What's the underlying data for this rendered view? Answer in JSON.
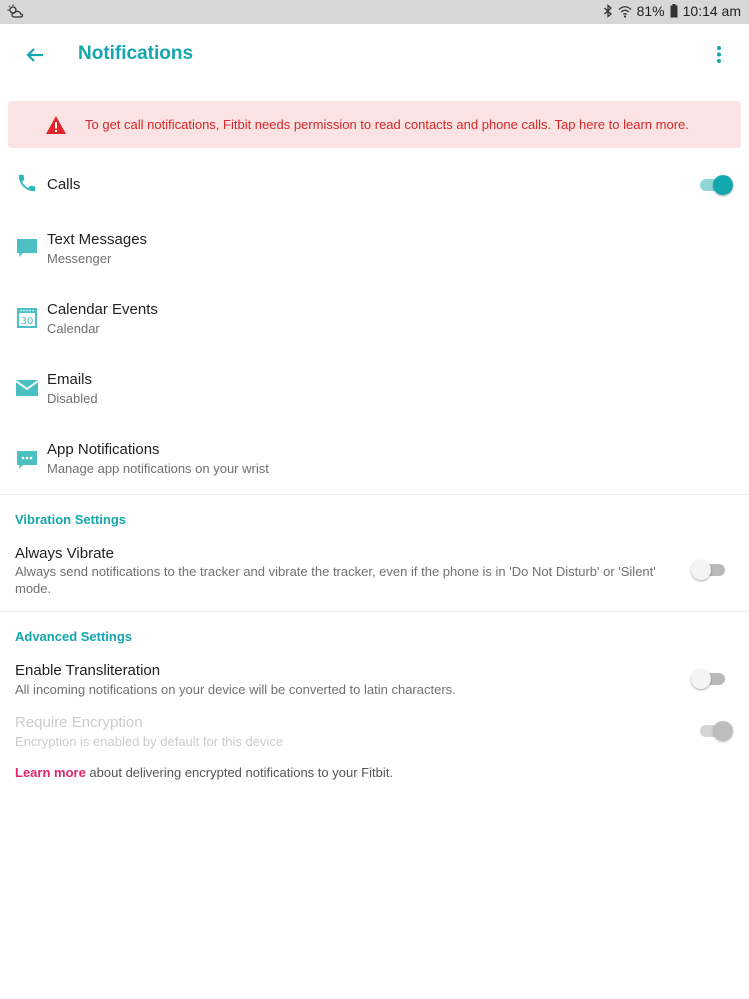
{
  "status_bar": {
    "battery": "81%",
    "time": "10:14 am",
    "icons": [
      "weather-icon",
      "bluetooth-icon",
      "wifi-icon",
      "battery-icon"
    ]
  },
  "header": {
    "title": "Notifications",
    "back_icon": "arrow-back-icon",
    "menu_icon": "more-vert-icon"
  },
  "banner": {
    "text": "To get call notifications, Fitbit needs permission to read contacts and phone calls. Tap here to learn more.",
    "icon": "warning-icon",
    "color": "#d8262a"
  },
  "notification_types": [
    {
      "title": "Calls",
      "subtitle": "",
      "icon": "phone-icon",
      "enabled": true
    },
    {
      "title": "Text Messages",
      "subtitle": "Messenger",
      "icon": "chat-bubble-icon"
    },
    {
      "title": "Calendar Events",
      "subtitle": "Calendar",
      "icon": "calendar-icon",
      "icon_text": "30"
    },
    {
      "title": "Emails",
      "subtitle": "Disabled",
      "icon": "envelope-icon"
    },
    {
      "title": "App Notifications",
      "subtitle": "Manage app notifications on your wrist",
      "icon": "app-chat-icon"
    }
  ],
  "vibration": {
    "section_title": "Vibration Settings",
    "always_vibrate": {
      "title": "Always Vibrate",
      "subtitle": "Always send notifications to the tracker and vibrate the tracker, even if the phone is in 'Do Not Disturb' or 'Silent' mode.",
      "enabled": false
    }
  },
  "advanced": {
    "section_title": "Advanced Settings",
    "transliteration": {
      "title": "Enable Transliteration",
      "subtitle": "All incoming notifications on your device will be converted to latin characters.",
      "enabled": false
    },
    "encryption": {
      "title": "Require Encryption",
      "subtitle": "Encryption is enabled by default for this device",
      "enabled": true,
      "disabled": true
    }
  },
  "footer": {
    "link_text": "Learn more",
    "rest_text": " about delivering encrypted notifications to your Fitbit."
  },
  "colors": {
    "accent": "#14a6ad",
    "link": "#e0266b",
    "banner_bg": "#fbe3e3"
  }
}
